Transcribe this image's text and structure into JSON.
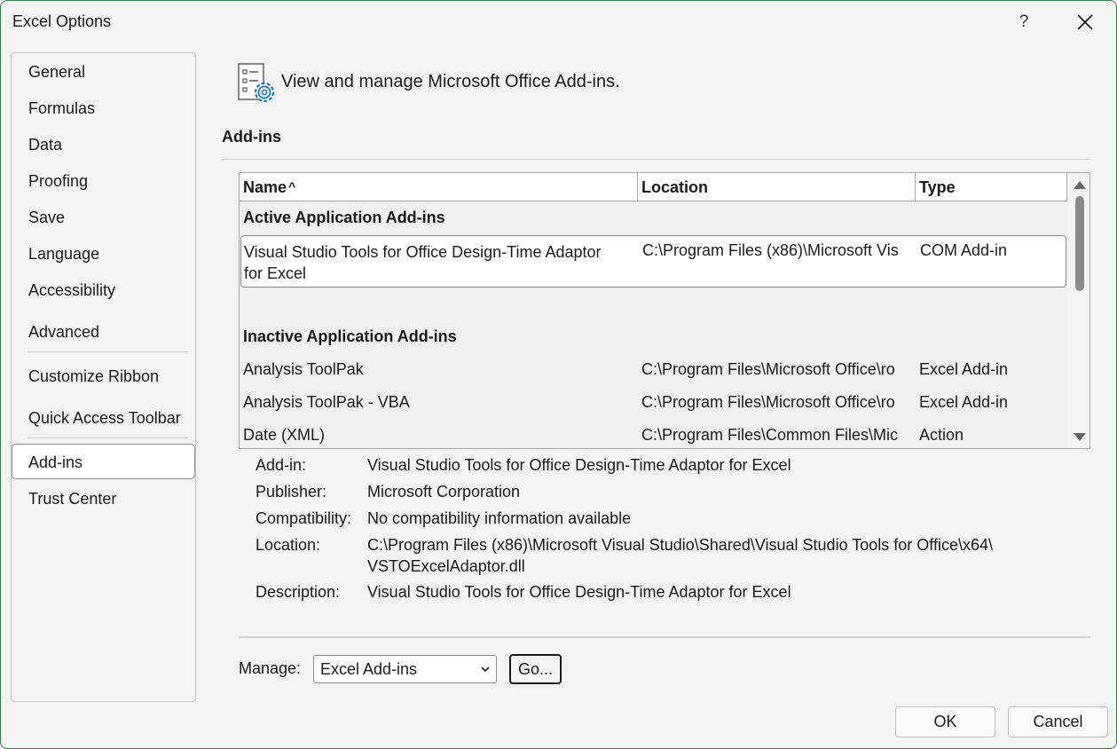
{
  "window": {
    "title": "Excel Options",
    "help_label": "?",
    "close_icon": "close-icon"
  },
  "sidebar": {
    "items": [
      {
        "label": "General"
      },
      {
        "label": "Formulas"
      },
      {
        "label": "Data"
      },
      {
        "label": "Proofing"
      },
      {
        "label": "Save"
      },
      {
        "label": "Language"
      },
      {
        "label": "Accessibility"
      },
      {
        "label": "Advanced"
      },
      {
        "label": "Customize Ribbon"
      },
      {
        "label": "Quick Access Toolbar"
      },
      {
        "label": "Add-ins",
        "selected": true
      },
      {
        "label": "Trust Center"
      }
    ]
  },
  "main": {
    "header_icon": "addins-settings-icon",
    "header_text": "View and manage Microsoft Office Add-ins.",
    "section_title": "Add-ins",
    "grid": {
      "columns": [
        {
          "label": "Name",
          "sort_icon": "sort-ascending-icon",
          "sort_glyph": "^"
        },
        {
          "label": "Location"
        },
        {
          "label": "Type"
        }
      ],
      "groups": [
        {
          "label": "Active Application Add-ins",
          "rows": [
            {
              "name_line1": "Visual Studio Tools for Office Design-Time Adaptor",
              "name_line2": "for Excel",
              "location": "C:\\Program Files (x86)\\Microsoft Vis",
              "type": "COM Add-in",
              "selected": true
            }
          ]
        },
        {
          "label": "Inactive Application Add-ins",
          "rows": [
            {
              "name": "Analysis ToolPak",
              "location": "C:\\Program Files\\Microsoft Office\\ro",
              "type": "Excel Add-in"
            },
            {
              "name": "Analysis ToolPak - VBA",
              "location": "C:\\Program Files\\Microsoft Office\\ro",
              "type": "Excel Add-in"
            },
            {
              "name": "Date (XML)",
              "location": "C:\\Program Files\\Common Files\\Mic",
              "type": "Action"
            }
          ]
        }
      ]
    },
    "details": {
      "addin_label": "Add-in:",
      "addin_value": "Visual Studio Tools for Office Design-Time Adaptor for Excel",
      "publisher_label": "Publisher:",
      "publisher_value": "Microsoft Corporation",
      "compat_label": "Compatibility:",
      "compat_value": "No compatibility information available",
      "location_label": "Location:",
      "location_value_line1": "C:\\Program Files (x86)\\Microsoft Visual Studio\\Shared\\Visual Studio Tools for Office\\x64\\",
      "location_value_line2": "VSTOExcelAdaptor.dll",
      "description_label": "Description:",
      "description_value": "Visual Studio Tools for Office Design-Time Adaptor for Excel"
    },
    "manage": {
      "label": "Manage:",
      "selected": "Excel Add-ins",
      "go_label": "Go..."
    }
  },
  "footer": {
    "ok_label": "OK",
    "cancel_label": "Cancel"
  }
}
